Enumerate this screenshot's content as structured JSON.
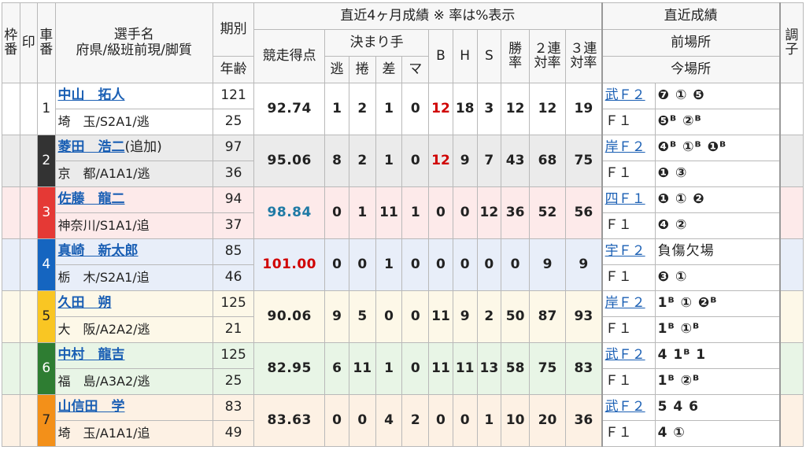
{
  "header": {
    "waku": "枠番",
    "shirushi": "印",
    "sha": "車番",
    "player_name": "選手名",
    "player_sub": "府県/級班前現/脚質",
    "period": "期別",
    "age": "年齢",
    "recent4": "直近4ヶ月成績 ※ 率は%表示",
    "score": "競走得点",
    "kimarite": "決まり手",
    "nige": "逃",
    "makuri": "捲",
    "sashi": "差",
    "mark": "マ",
    "b": "B",
    "h": "H",
    "s": "S",
    "win": "勝率",
    "ren2": "２連対率",
    "ren3": "３連対率",
    "recent_results": "直近成績",
    "prev_venue": "前場所",
    "this_venue": "今場所",
    "condition": "調子"
  },
  "riders": [
    {
      "car": "1",
      "name": "中山　拓人",
      "note": "",
      "pref": "埼　玉/S2A1/逃",
      "period": "121",
      "age": "25",
      "score": "92.74",
      "nige": "1",
      "makuri": "2",
      "sashi": "1",
      "mark": "0",
      "b": "12",
      "h": "18",
      "s": "3",
      "win": "12",
      "ren2": "12",
      "ren3": "19",
      "prev_place": "武Ｆ２",
      "prev_results": "❼ ① ❺",
      "this_place": "Ｆ１",
      "this_results": "❺ᴮ ②ᴮ"
    },
    {
      "car": "2",
      "name": "菱田　浩二",
      "note": "(追加)",
      "pref": "京　都/A1A1/逃",
      "period": "97",
      "age": "36",
      "score": "95.06",
      "nige": "8",
      "makuri": "2",
      "sashi": "1",
      "mark": "0",
      "b": "12",
      "h": "9",
      "s": "7",
      "win": "43",
      "ren2": "68",
      "ren3": "75",
      "prev_place": "岸Ｆ２",
      "prev_results": "❹ᴮ ①ᴮ ❶ᴮ",
      "this_place": "Ｆ１",
      "this_results": "❶ ③"
    },
    {
      "car": "3",
      "name": "佐藤　龍二",
      "note": "",
      "pref": "神奈川/S1A1/追",
      "period": "94",
      "age": "37",
      "score": "98.84",
      "nige": "0",
      "makuri": "1",
      "sashi": "11",
      "mark": "1",
      "b": "0",
      "h": "0",
      "s": "12",
      "win": "36",
      "ren2": "52",
      "ren3": "56",
      "prev_place": "四Ｆ１",
      "prev_results": "❶ ① ❷",
      "this_place": "Ｆ１",
      "this_results": "❹ ②"
    },
    {
      "car": "4",
      "name": "真崎　新太郎",
      "note": "",
      "pref": "栃　木/S2A1/追",
      "period": "85",
      "age": "46",
      "score": "101.00",
      "nige": "0",
      "makuri": "0",
      "sashi": "1",
      "mark": "0",
      "b": "0",
      "h": "0",
      "s": "0",
      "win": "0",
      "ren2": "9",
      "ren3": "9",
      "prev_place": "宇Ｆ２",
      "prev_results": "負傷欠場",
      "this_place": "Ｆ１",
      "this_results": "❸ ①"
    },
    {
      "car": "5",
      "name": "久田　朔",
      "note": "",
      "pref": "大　阪/A2A2/逃",
      "period": "125",
      "age": "21",
      "score": "90.06",
      "nige": "9",
      "makuri": "5",
      "sashi": "0",
      "mark": "0",
      "b": "11",
      "h": "9",
      "s": "2",
      "win": "50",
      "ren2": "87",
      "ren3": "93",
      "prev_place": "岸Ｆ２",
      "prev_results": "1ᴮ ① ❷ᴮ",
      "this_place": "Ｆ１",
      "this_results": "1ᴮ ①ᴮ"
    },
    {
      "car": "6",
      "name": "中村　龍吉",
      "note": "",
      "pref": "福　島/A3A2/逃",
      "period": "125",
      "age": "25",
      "score": "82.95",
      "nige": "6",
      "makuri": "11",
      "sashi": "1",
      "mark": "0",
      "b": "11",
      "h": "11",
      "s": "13",
      "win": "58",
      "ren2": "75",
      "ren3": "83",
      "prev_place": "武Ｆ２",
      "prev_results": "4  1ᴮ 1",
      "this_place": "Ｆ１",
      "this_results": "1ᴮ ②ᴮ"
    },
    {
      "car": "7",
      "name": "山信田　学",
      "note": "",
      "pref": "埼　玉/A1A1/追",
      "period": "83",
      "age": "49",
      "score": "83.63",
      "nige": "0",
      "makuri": "0",
      "sashi": "4",
      "mark": "2",
      "b": "0",
      "h": "0",
      "s": "1",
      "win": "10",
      "ren2": "20",
      "ren3": "36",
      "prev_place": "武Ｆ２",
      "prev_results": "5  4  6",
      "this_place": "Ｆ１",
      "this_results": "4  ①"
    }
  ],
  "colors": {
    "accent_link": "#1a5fb4",
    "highlight_red": "#d00000",
    "highlight_blue": "#1f7aa5"
  }
}
